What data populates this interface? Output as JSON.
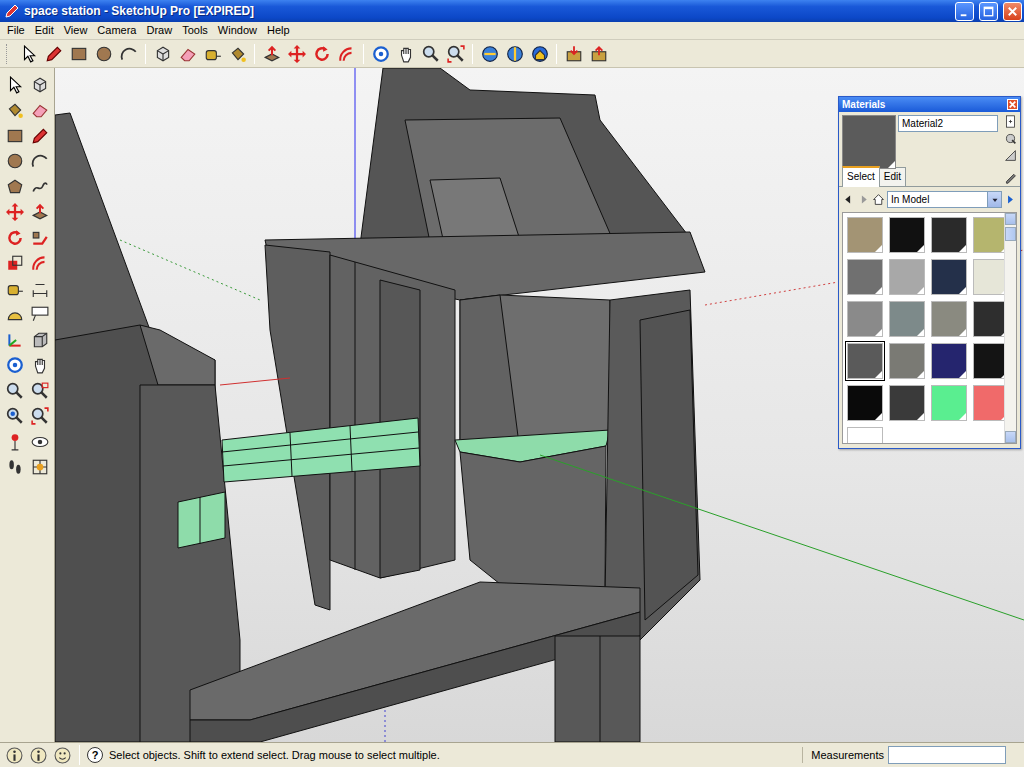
{
  "window": {
    "title": "space station - SketchUp Pro [EXPIRED]"
  },
  "menu": [
    "File",
    "Edit",
    "View",
    "Camera",
    "Draw",
    "Tools",
    "Window",
    "Help"
  ],
  "materials_panel": {
    "title": "Materials",
    "material_name": "Material2",
    "tabs": [
      {
        "label": "Select",
        "selected": true
      },
      {
        "label": "Edit",
        "selected": false
      }
    ],
    "collection": "In Model",
    "swatches": [
      {
        "color": "#a39474",
        "selected": false
      },
      {
        "color": "#111111",
        "selected": false
      },
      {
        "color": "#2a2a2a",
        "selected": false
      },
      {
        "color": "#b5b56e",
        "selected": false
      },
      {
        "color": "#707070",
        "selected": false
      },
      {
        "color": "#a8a8a8",
        "selected": false
      },
      {
        "color": "#24304a",
        "selected": false
      },
      {
        "color": "#e6e6d8",
        "selected": false
      },
      {
        "color": "#8a8a8a",
        "selected": false
      },
      {
        "color": "#7d8a8a",
        "selected": false
      },
      {
        "color": "#8a8a80",
        "selected": false
      },
      {
        "color": "#2e2e2e",
        "selected": false
      },
      {
        "color": "#5a5a5a",
        "selected": true
      },
      {
        "color": "#7a7a74",
        "selected": false
      },
      {
        "color": "#25256e",
        "selected": false
      },
      {
        "color": "#141414",
        "selected": false
      },
      {
        "color": "#0a0a0a",
        "selected": false
      },
      {
        "color": "#3a3a3a",
        "selected": false
      },
      {
        "color": "#5aee90",
        "selected": false
      },
      {
        "color": "#f06a6a",
        "selected": false
      },
      {
        "color": "#ffffff",
        "selected": false
      }
    ]
  },
  "status_bar": {
    "help_glyph": "?",
    "message": "Select objects. Shift to extend select. Drag mouse to select multiple.",
    "measurements_label": "Measurements"
  }
}
